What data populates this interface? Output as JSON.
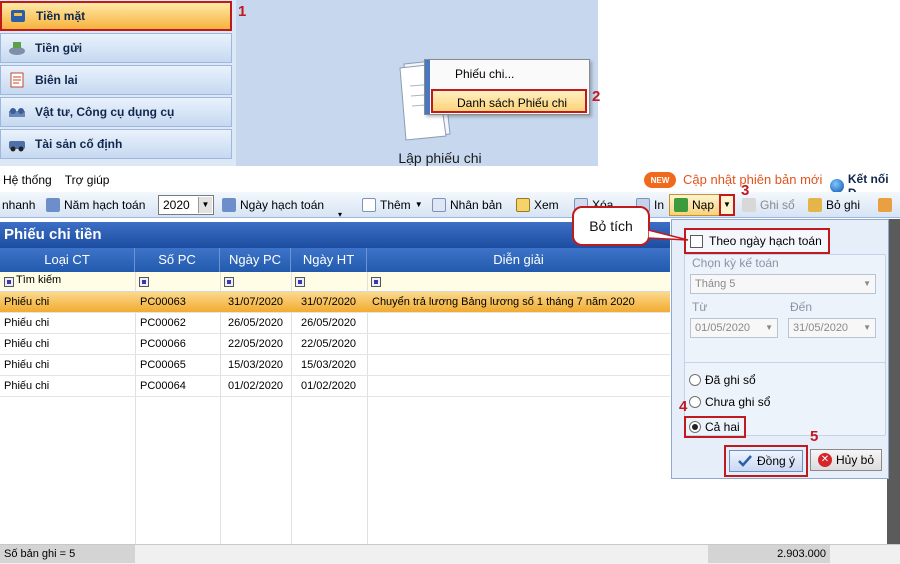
{
  "nav": {
    "items": [
      {
        "label": "Tiền mặt",
        "icon": "cash-box-icon"
      },
      {
        "label": "Tiền gửi",
        "icon": "bank-deposit-icon"
      },
      {
        "label": "Biên lai",
        "icon": "receipt-icon"
      },
      {
        "label": "Vật tư, Công cụ dụng cụ",
        "icon": "tools-icon"
      },
      {
        "label": "Tài sản cố định",
        "icon": "fixed-asset-icon"
      }
    ]
  },
  "main": {
    "lap_phieu_chi": "Lập phiếu chi"
  },
  "context_menu": {
    "items": [
      "Phiếu chi...",
      "Danh sách Phiếu chi"
    ]
  },
  "menubar": {
    "items": [
      "Hệ thống",
      "Trợ giúp"
    ],
    "new_badge": "NEW",
    "update": "Cập nhật phiên bản mới",
    "connect": "Kết nối D"
  },
  "toolbar": {
    "quick": "nhanh",
    "year_label": "Năm hạch toán",
    "year_value": "2020",
    "post_date": "Ngày hạch toán",
    "add": "Thêm",
    "duplicate": "Nhân bản",
    "view": "Xem",
    "delete": "Xóa",
    "print": "In",
    "reload": "Nạp",
    "post": "Ghi sổ",
    "unpost": "Bỏ ghi"
  },
  "grid": {
    "title": "Phiếu chi tiền",
    "columns": [
      "Loại CT",
      "Số PC",
      "Ngày PC",
      "Ngày HT",
      "Diễn giải"
    ],
    "search_placeholder": "Tìm kiếm",
    "rows": [
      {
        "type": "Phiếu chi",
        "no": "PC00063",
        "date": "31/07/2020",
        "post": "31/07/2020",
        "desc": "Chuyển trả lương Bảng lương số 1 tháng 7 năm 2020"
      },
      {
        "type": "Phiếu chi",
        "no": "PC00062",
        "date": "26/05/2020",
        "post": "26/05/2020",
        "desc": ""
      },
      {
        "type": "Phiếu chi",
        "no": "PC00066",
        "date": "22/05/2020",
        "post": "22/05/2020",
        "desc": ""
      },
      {
        "type": "Phiếu chi",
        "no": "PC00065",
        "date": "15/03/2020",
        "post": "15/03/2020",
        "desc": ""
      },
      {
        "type": "Phiếu chi",
        "no": "PC00064",
        "date": "01/02/2020",
        "post": "01/02/2020",
        "desc": ""
      }
    ]
  },
  "status": {
    "count": "Số bản ghi = 5",
    "total": "2.903.000"
  },
  "popup": {
    "by_post_date": "Theo ngày hạch toán",
    "period_label": "Chọn kỳ kế toán",
    "period_value": "Tháng 5",
    "from_label": "Từ",
    "from_value": "01/05/2020",
    "to_label": "Đến",
    "to_value": "31/05/2020",
    "opt_posted": "Đã ghi sổ",
    "opt_unposted": "Chưa ghi sổ",
    "opt_both": "Cả hai",
    "ok": "Đồng ý",
    "cancel": "Hủy bỏ"
  },
  "annotations": {
    "callout": "Bỏ tích",
    "n1": "1",
    "n2": "2",
    "n3": "3",
    "n4": "4",
    "n5": "5"
  },
  "colors": {
    "accent_red": "#c0191e",
    "selected_row": "#f2ab2f",
    "header_blue": "#225aad"
  }
}
